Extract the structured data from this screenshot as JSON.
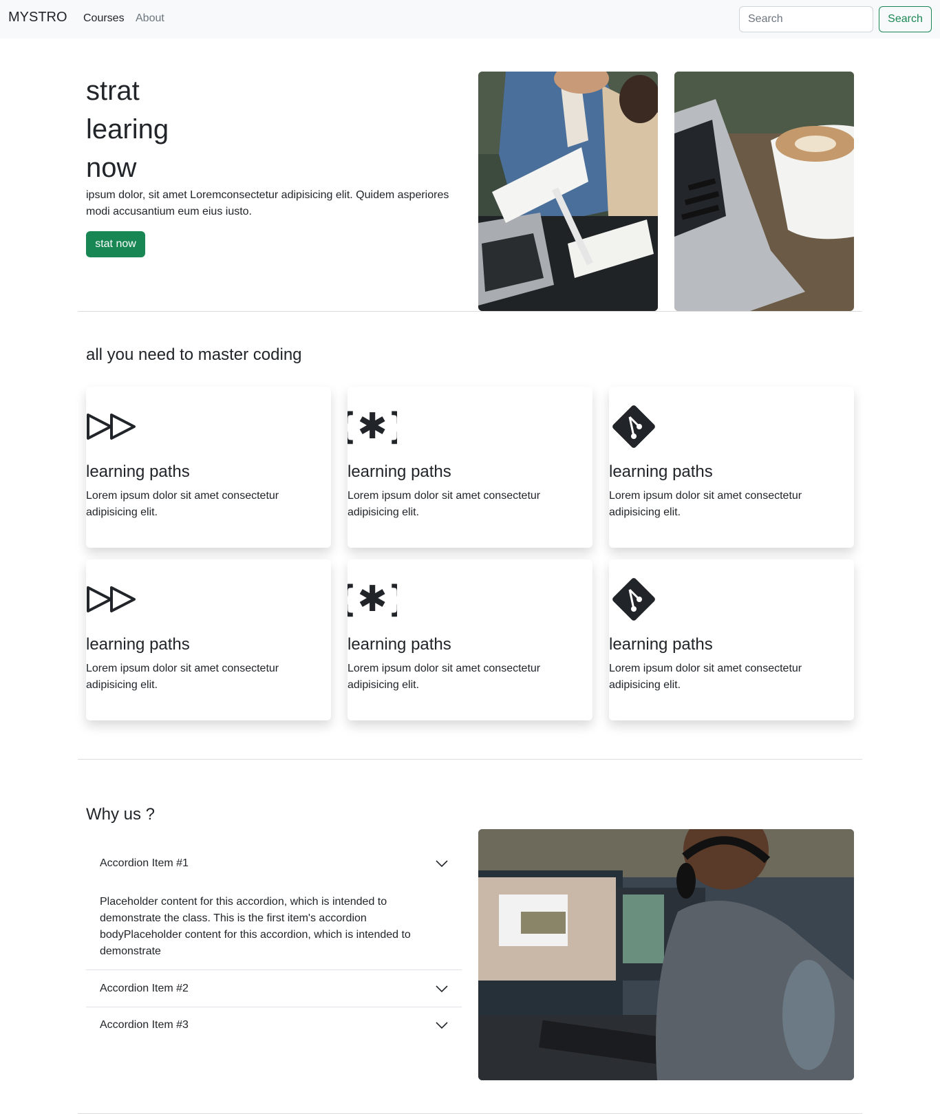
{
  "navbar": {
    "brand": "MYSTRO",
    "links": [
      "Courses",
      "About"
    ],
    "search_placeholder": "Search",
    "search_button": "Search"
  },
  "hero": {
    "title_lines": [
      "strat",
      "learing",
      "now"
    ],
    "text": "ipsum dolor, sit amet Loremconsectetur adipisicing elit. Quidem asperiores modi accusantium eum eius iusto.",
    "button": "stat now"
  },
  "features": {
    "title": "all you need to master coding",
    "cards": [
      {
        "icon": "fast-forward-icon",
        "title": "learning paths",
        "text": "Lorem ipsum dolor sit amet consectetur adipisicing elit."
      },
      {
        "icon": "braces-asterisk-icon",
        "title": "learning paths",
        "text": "Lorem ipsum dolor sit amet consectetur adipisicing elit."
      },
      {
        "icon": "git-icon",
        "title": "learning paths",
        "text": "Lorem ipsum dolor sit amet consectetur adipisicing elit."
      },
      {
        "icon": "fast-forward-icon",
        "title": "learning paths",
        "text": "Lorem ipsum dolor sit amet consectetur adipisicing elit."
      },
      {
        "icon": "braces-asterisk-icon",
        "title": "learning paths",
        "text": "Lorem ipsum dolor sit amet consectetur adipisicing elit."
      },
      {
        "icon": "git-icon",
        "title": "learning paths",
        "text": "Lorem ipsum dolor sit amet consectetur adipisicing elit."
      }
    ]
  },
  "why": {
    "title": "Why us ?",
    "items": [
      {
        "label": "Accordion Item #1",
        "body": "Placeholder content for this accordion, which is intended to demonstrate the class. This is the first item's accordion bodyPlaceholder content for this accordion, which is intended to demonstrate",
        "expanded": true
      },
      {
        "label": "Accordion Item #2",
        "expanded": false
      },
      {
        "label": "Accordion Item #3",
        "expanded": false
      }
    ]
  }
}
